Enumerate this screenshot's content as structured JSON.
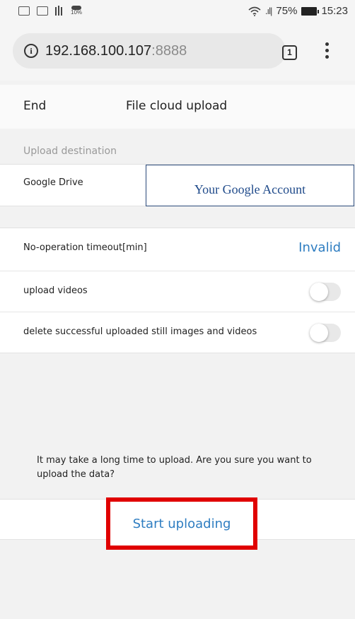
{
  "status_bar": {
    "left_icons": [
      "image-icon",
      "image-icon",
      "barcode-icon",
      "notification-icon"
    ],
    "small_badge": "10%",
    "battery": "75%",
    "time": "15:23"
  },
  "browser": {
    "url_host": "192.168.100.107",
    "url_port": ":8888",
    "tab_count": "1"
  },
  "header": {
    "end_label": "End",
    "title": "File cloud upload"
  },
  "destination": {
    "section_label": "Upload destination",
    "service": "Google Drive",
    "account": "Your Google Account"
  },
  "settings": {
    "timeout_label": "No-operation timeout[min]",
    "timeout_value": "Invalid",
    "upload_videos_label": "upload videos",
    "upload_videos_on": false,
    "delete_label": "delete successful uploaded still images and videos",
    "delete_on": false
  },
  "confirm": {
    "message": "It may take a long time to upload. Are you sure you want to upload the data?",
    "button": "Start uploading"
  },
  "colors": {
    "accent": "#2e7dc1",
    "highlight": "#e00000"
  }
}
